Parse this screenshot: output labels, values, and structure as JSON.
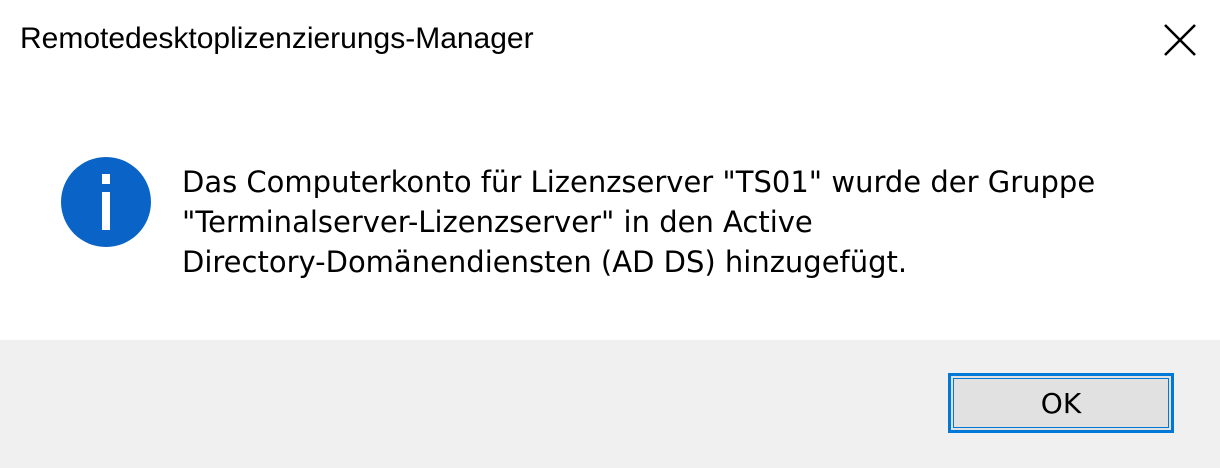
{
  "window": {
    "title": "Remotedesktoplizenzierungs-Manager",
    "close_icon": "close-icon"
  },
  "message": {
    "icon": "info-icon",
    "lines": [
      "Das Computerkonto für Lizenzserver \"TS01\" wurde der Gruppe",
      "\"Terminalserver-Lizenzserver\" in den Active",
      "Directory-Domänendiensten (AD DS) hinzugefügt."
    ]
  },
  "buttons": {
    "ok_label": "OK"
  },
  "colors": {
    "accent": "#0078d7",
    "info_icon": "#0a64c8",
    "footer_bg": "#f0f0f0",
    "button_bg": "#e1e1e1"
  }
}
